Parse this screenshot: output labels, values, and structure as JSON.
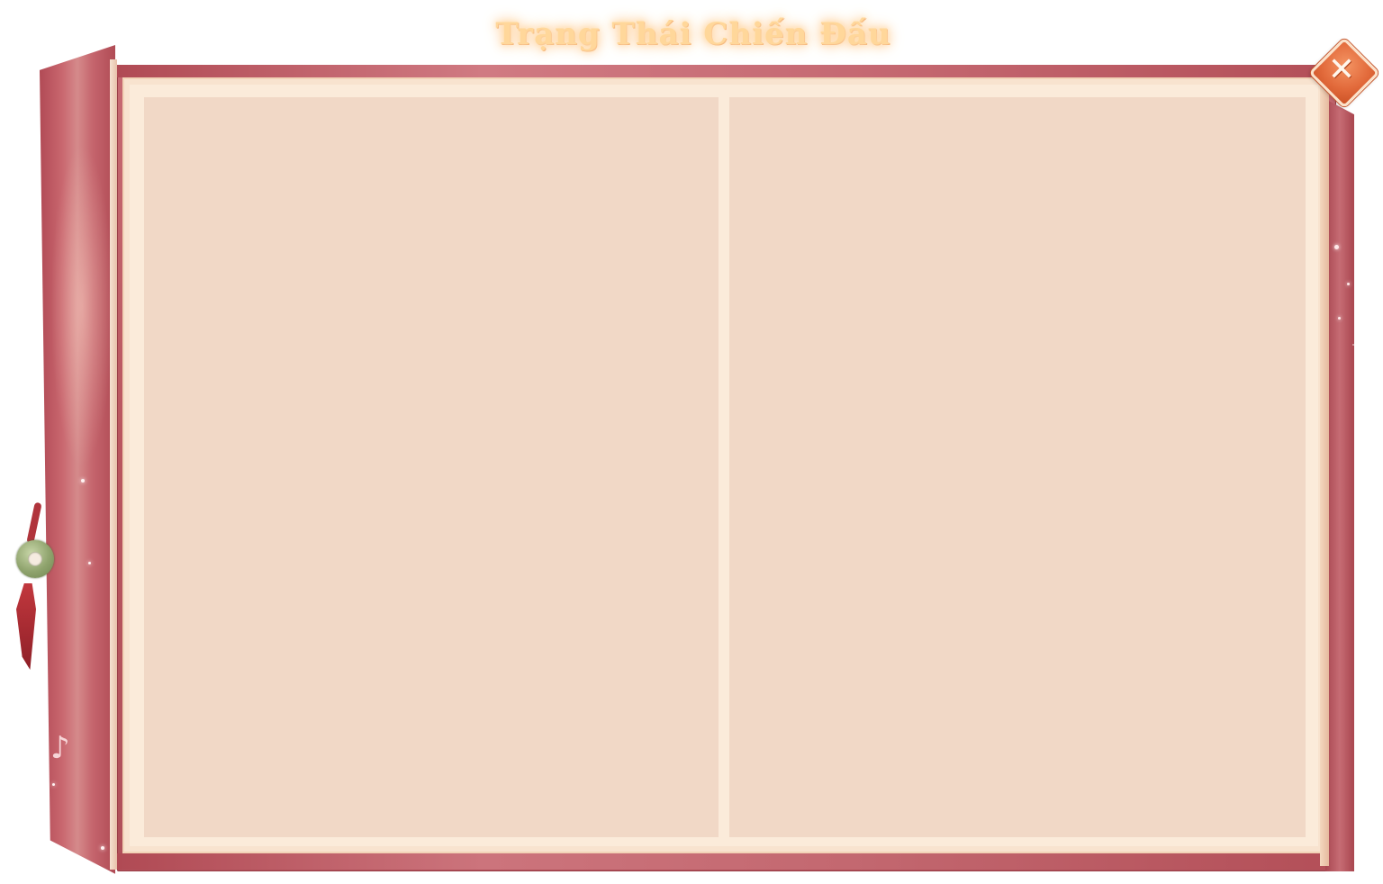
{
  "window": {
    "title": "Trạng Thái Chiến Đấu"
  },
  "close_button": {
    "icon": "close-icon",
    "glyph": "✕"
  },
  "decor": {
    "music_note_glyph": "♪",
    "pendant": "jade-pendant-icon"
  },
  "panels": {
    "left": [],
    "right": []
  },
  "colors": {
    "cover": "#b9555e",
    "paper": "#fbebda",
    "panel": "#f1d8c6",
    "title_glow": "#ffd79a",
    "close_button": "#e26a3b"
  }
}
